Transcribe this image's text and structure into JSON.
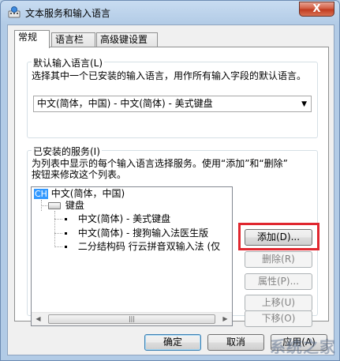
{
  "window": {
    "title": "文本服务和输入语言",
    "close_symbol": "X"
  },
  "tabs": [
    {
      "label": "常规",
      "active": true
    },
    {
      "label": "语言栏",
      "active": false
    },
    {
      "label": "高级键设置",
      "active": false
    }
  ],
  "default_language": {
    "group_label": "默认输入语言(L)",
    "description": "选择其中一个已安装的输入语言，用作所有输入字段的默认语言。",
    "selected": "中文(简体，中国) - 中文(简体) - 美式键盘"
  },
  "installed_services": {
    "group_label": "已安装的服务(I)",
    "description_line1": "为列表中显示的每个输入语言选择服务。使用“添加”和“删除”",
    "description_line2": "按钮来修改这个列表。",
    "tree": {
      "language_tag": "CH",
      "language": "中文(简体，中国)",
      "category": "键盘",
      "items": [
        "中文(简体) - 美式键盘",
        "中文(简体) - 搜狗输入法医生版",
        "二分结构码 行云拼音双输入法 (仅"
      ]
    },
    "buttons": {
      "add": "添加(D)...",
      "remove": "删除(R)",
      "properties": "属性(P)...",
      "move_up": "上移(U)",
      "move_down": "下移(O)"
    }
  },
  "footer": {
    "ok": "确定",
    "cancel": "取消",
    "apply": "应用(A)"
  },
  "watermark": "系统之家",
  "highlight_color": "#e0272f"
}
